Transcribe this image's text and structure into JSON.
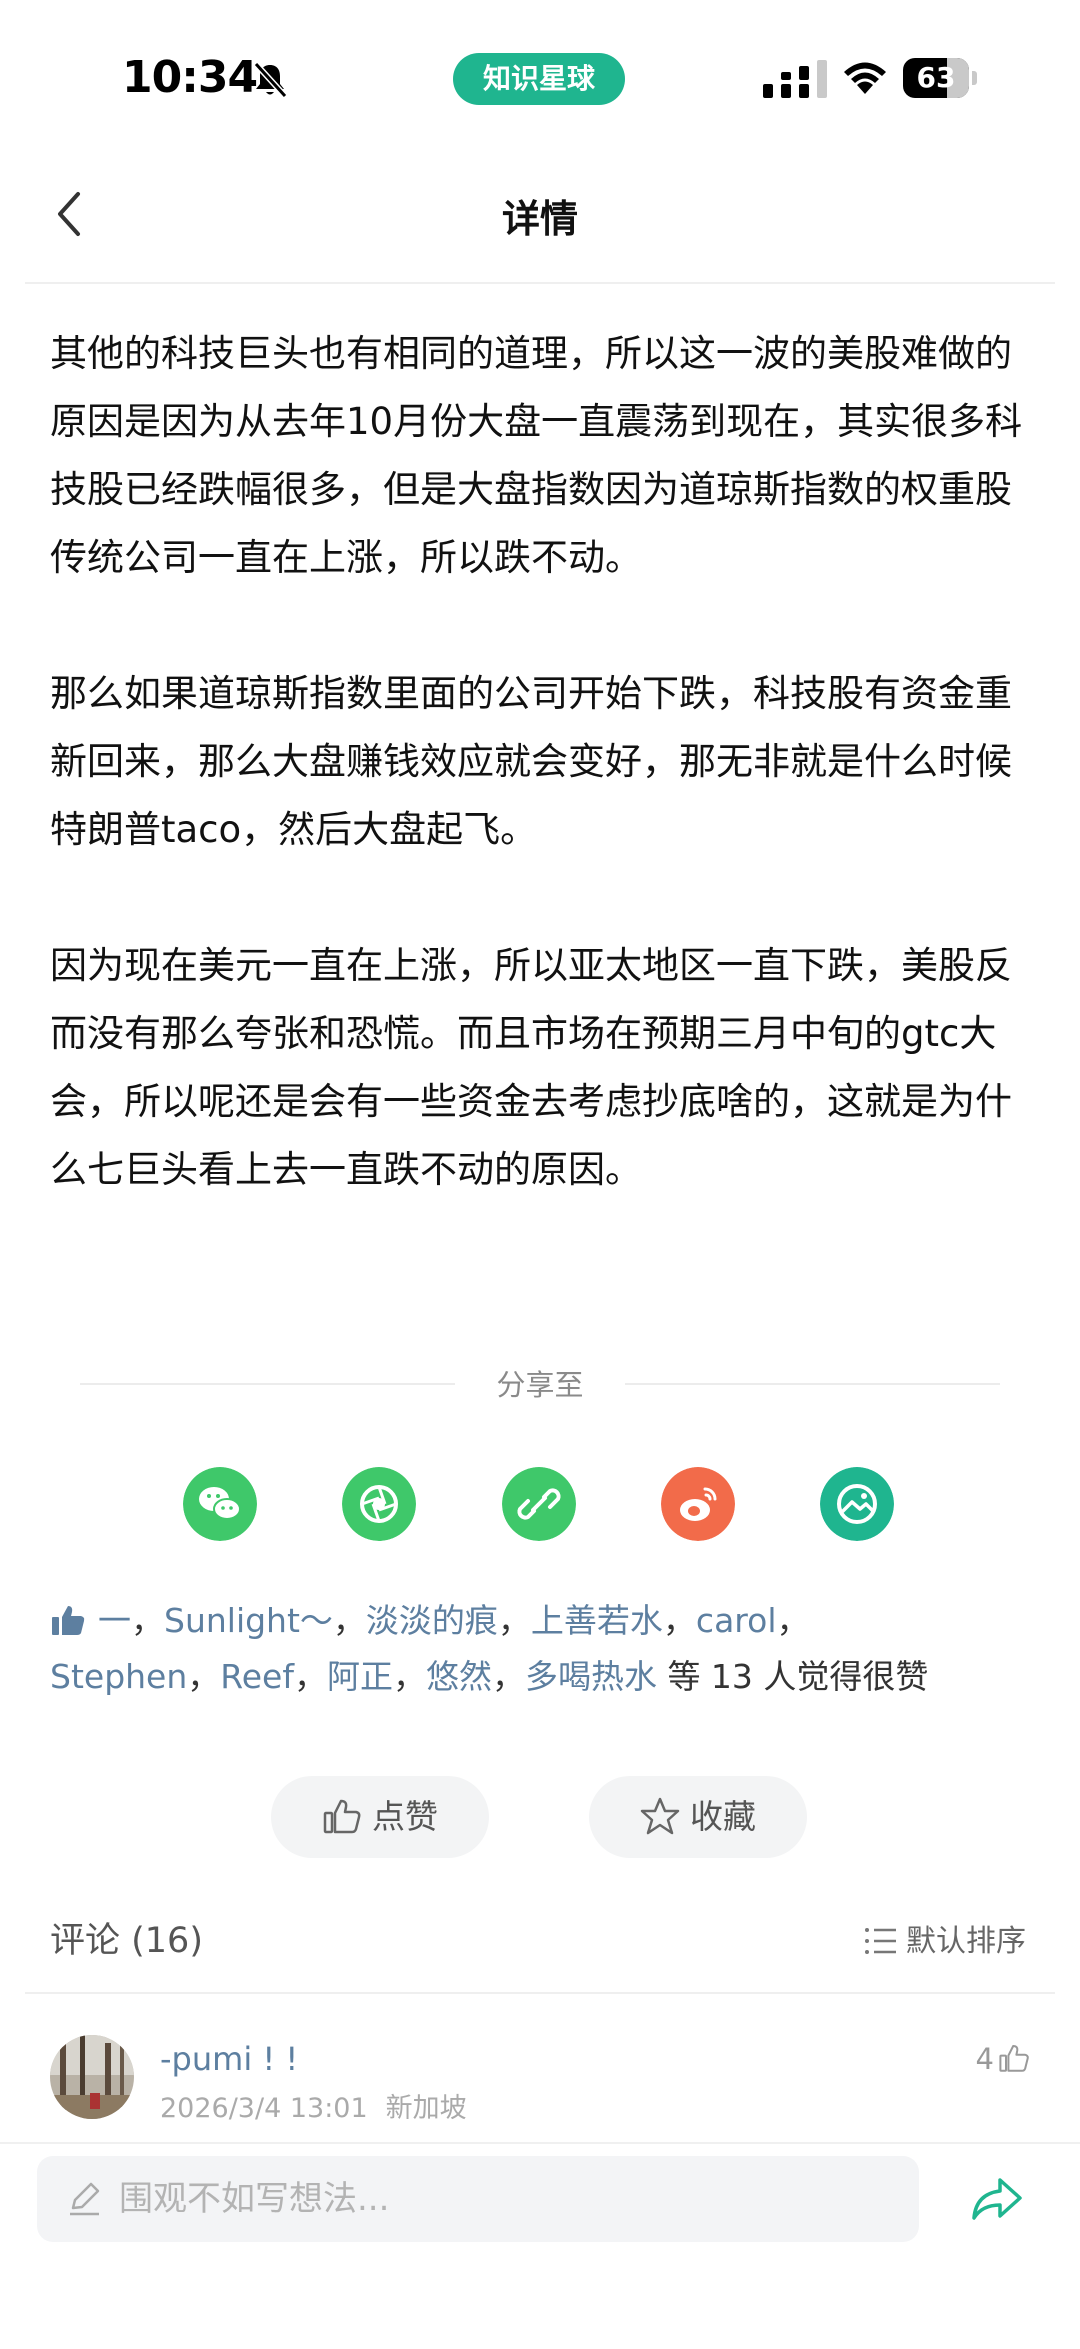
{
  "status_bar": {
    "time": "10:34",
    "app_label": "知识星球",
    "battery": "63"
  },
  "nav": {
    "title": "详情"
  },
  "article": {
    "paragraphs": [
      "其他的科技巨头也有相同的道理，所以这一波的美股难做的原因是因为从去年10月份大盘一直震荡到现在，其实很多科技股已经跌幅很多，但是大盘指数因为道琼斯指数的权重股传统公司一直在上涨，所以跌不动。",
      "那么如果道琼斯指数里面的公司开始下跌，科技股有资金重新回来，那么大盘赚钱效应就会变好，那无非就是什么时候特朗普taco，然后大盘起飞。",
      "因为现在美元一直在上涨，所以亚太地区一直下跌，美股反而没有那么夸张和恐慌。而且市场在预期三月中旬的gtc大会，所以呢还是会有一些资金去考虑抄底啥的，这就是为什么七巨头看上去一直跌不动的原因。"
    ]
  },
  "share": {
    "label": "分享至",
    "icons": [
      {
        "name": "wechat-icon",
        "color": "#3fc86a"
      },
      {
        "name": "moments-icon",
        "color": "#3fc86a"
      },
      {
        "name": "link-icon",
        "color": "#3fc86a"
      },
      {
        "name": "weibo-icon",
        "color": "#f26b4a"
      },
      {
        "name": "image-icon",
        "color": "#1fb58f"
      }
    ]
  },
  "likes": {
    "names": [
      "一",
      "Sunlight～",
      "淡淡的痕",
      "上善若水",
      "carol",
      "Stephen",
      "Reef",
      "阿正",
      "悠然",
      "多喝热水"
    ],
    "separator": "，",
    "suffix": " 等 13 人觉得很赞"
  },
  "actions": {
    "like_label": "点赞",
    "favorite_label": "收藏"
  },
  "comments": {
    "header": "评论 (16)",
    "sort_label": "默认排序",
    "items": [
      {
        "author": "-pumi ! !",
        "time": "2026/3/4 13:01",
        "location": "新加坡",
        "likes": "4"
      }
    ]
  },
  "input": {
    "placeholder": "围观不如写想法..."
  },
  "colors": {
    "accent": "#1fb58f",
    "link": "#5d7fa0"
  }
}
